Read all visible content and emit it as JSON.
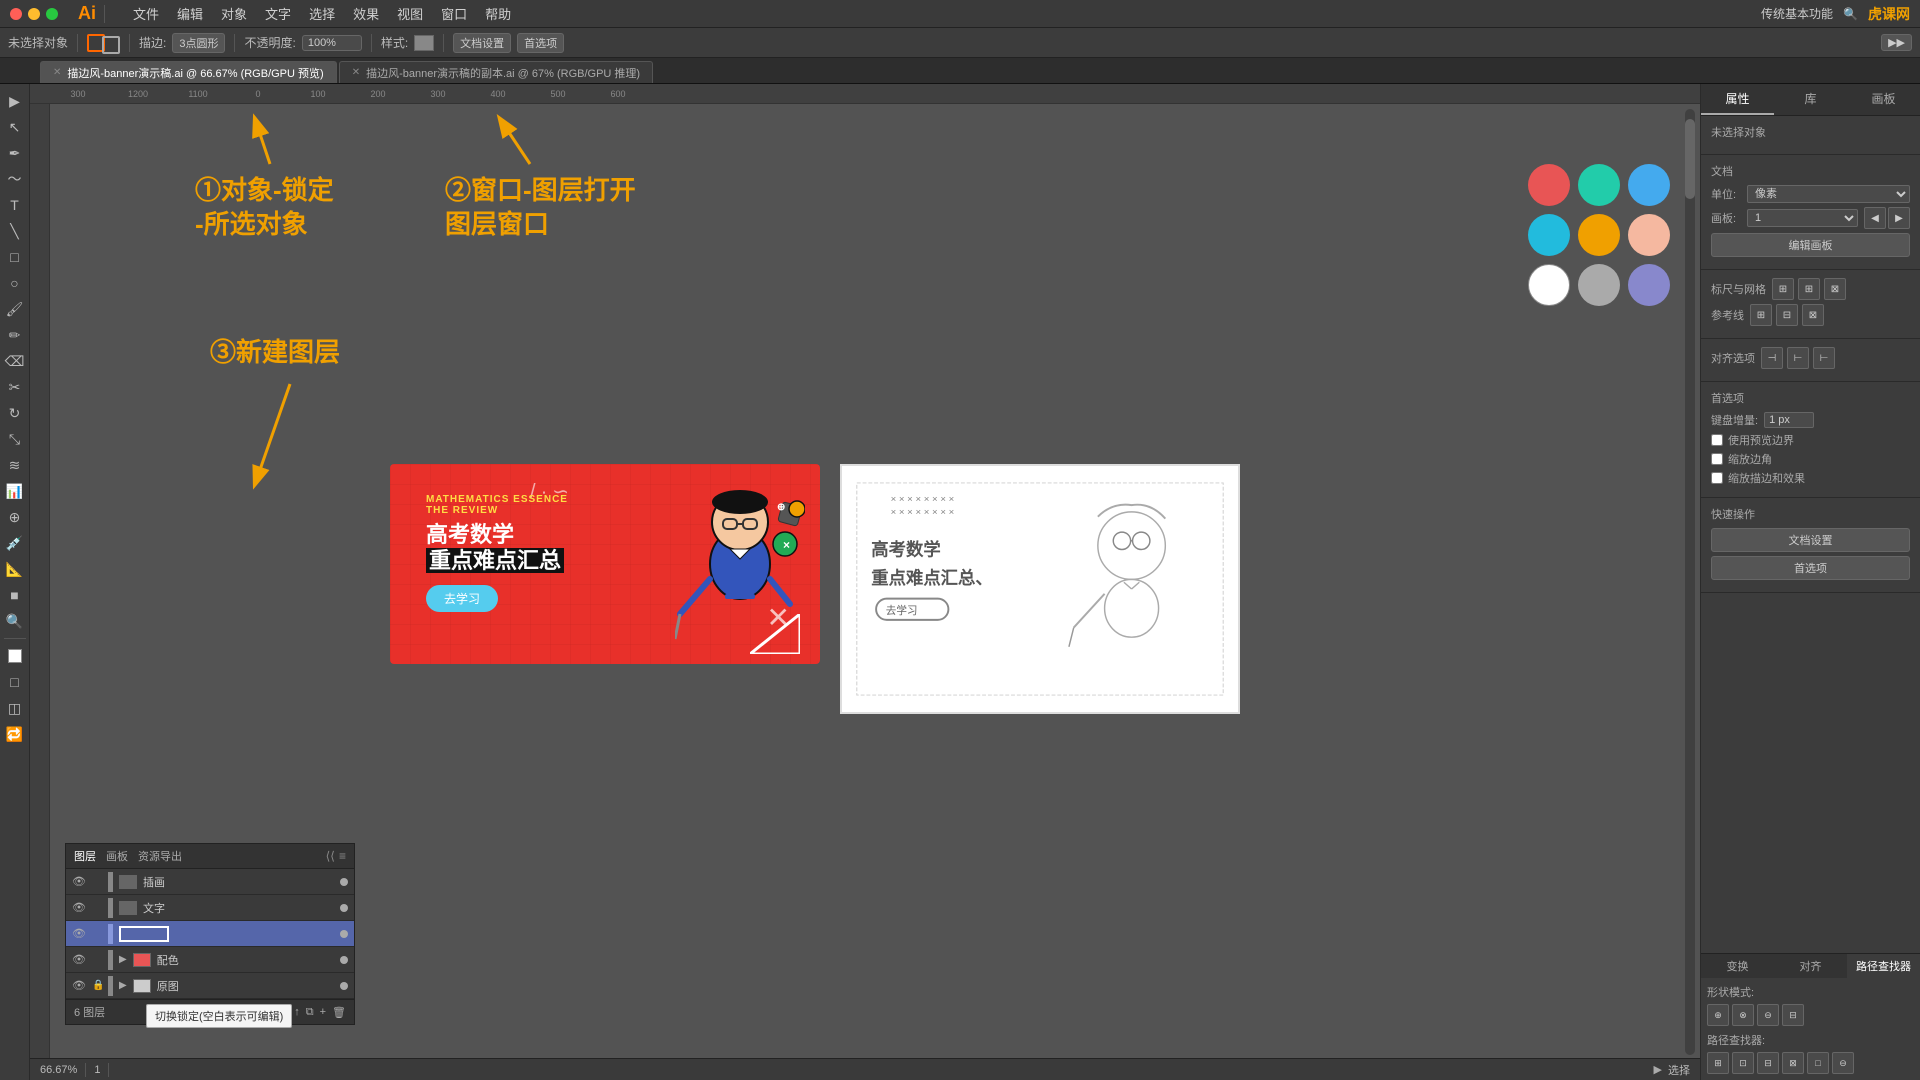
{
  "app": {
    "name": "Illustrator CC",
    "logo": "Ai",
    "zoom": "66.67%",
    "mode": "选择"
  },
  "menu": {
    "items": [
      "文件",
      "编辑",
      "对象",
      "文字",
      "选择",
      "效果",
      "视图",
      "窗口",
      "帮助"
    ]
  },
  "toolbar": {
    "no_selection": "未选择对象",
    "stroke_label": "描边:",
    "stroke_val": "3点圆形",
    "opacity_label": "不透明度:",
    "opacity_val": "100%",
    "style_label": "样式:",
    "doc_settings": "文档设置",
    "preferences": "首选项"
  },
  "tabs": [
    {
      "label": "描边风-banner演示稿.ai @ 66.67% (RGB/GPU 预览)",
      "active": true
    },
    {
      "label": "描边风-banner演示稿的副本.ai @ 67% (RGB/GPU 推理)",
      "active": false
    }
  ],
  "annotations": {
    "ann1": "①对象-锁定\n-所选对象",
    "ann2": "②窗口-图层打开\n图层窗口",
    "ann3": "③新建图层"
  },
  "layers_panel": {
    "title": "图层",
    "tabs": [
      "图层",
      "画板",
      "资源导出"
    ],
    "layers": [
      {
        "name": "插画",
        "visible": true,
        "locked": false,
        "dot_color": "#aaaaaa"
      },
      {
        "name": "文字",
        "visible": true,
        "locked": false,
        "dot_color": "#aaaaaa"
      },
      {
        "name": "",
        "visible": true,
        "locked": false,
        "dot_color": "#aaaaaa",
        "active": true
      },
      {
        "name": "配色",
        "visible": true,
        "locked": false,
        "dot_color": "#aaaaaa",
        "group": true
      },
      {
        "name": "原图",
        "visible": true,
        "locked": true,
        "dot_color": "#aaaaaa",
        "group": true
      }
    ],
    "count": "6 图层",
    "tooltip": "切换锁定(空白表示可编辑)"
  },
  "right_panel": {
    "tabs": [
      "属性",
      "库",
      "画板"
    ],
    "active_tab": "属性",
    "selection": "未选择对象",
    "doc_section": "文档",
    "unit_label": "单位:",
    "unit_val": "像素",
    "artboard_label": "画板:",
    "artboard_val": "1",
    "edit_artboard_btn": "编辑画板",
    "scale_label": "标尺与网格",
    "guide_label": "参考线",
    "align_label": "对齐选项",
    "snap_label": "首选项",
    "keyboard_label": "键盘增量:",
    "keyboard_val": "1 px",
    "snap_bounds_label": "使用预览边界",
    "corner_label": "缩放边角",
    "scale_effects_label": "缩放描边和效果",
    "quick_actions": "快速操作",
    "doc_settings_btn": "文档设置",
    "preferences_btn": "首选项"
  },
  "swatches": [
    {
      "color": "#e85555",
      "name": "red"
    },
    {
      "color": "#22ccaa",
      "name": "teal"
    },
    {
      "color": "#44aaee",
      "name": "light-blue"
    },
    {
      "color": "#22bbdd",
      "name": "cyan"
    },
    {
      "color": "#f0a000",
      "name": "orange"
    },
    {
      "color": "#f5b8a0",
      "name": "peach"
    },
    {
      "color": "#ffffff",
      "name": "white"
    },
    {
      "color": "#aaaaaa",
      "name": "gray"
    },
    {
      "color": "#8888cc",
      "name": "blue-gray"
    }
  ],
  "bottom_panel": {
    "tabs": [
      "变换",
      "对齐",
      "路径查找器"
    ],
    "active_tab": "路径查找器",
    "shape_modes_label": "形状模式:",
    "pathfinder_label": "路径查找器:"
  },
  "statusbar": {
    "zoom": "66.67%",
    "page": "1",
    "mode": "选择"
  },
  "banner": {
    "subtitle1": "MATHEMATICS ESSENCE",
    "subtitle2": "THE REVIEW",
    "title1": "高考数学",
    "title2": "重点难点汇总",
    "btn": "去学习"
  },
  "watermark": "传统基本功能"
}
